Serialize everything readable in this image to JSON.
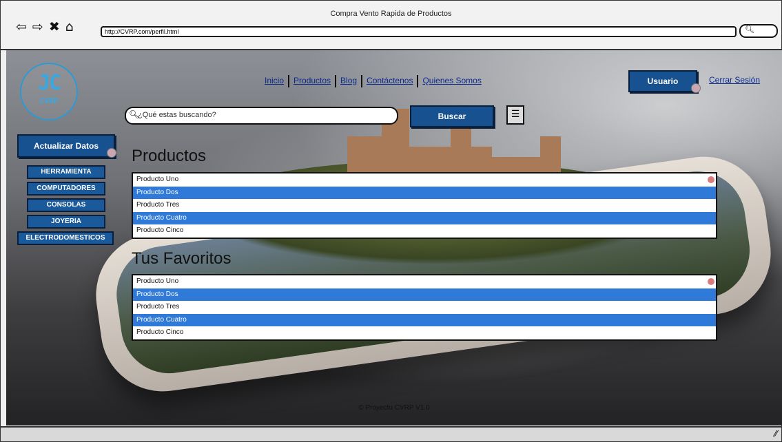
{
  "window": {
    "title": "Compra Vento Rapida de Productos",
    "url": "http://CVRP.com/perfil.html"
  },
  "logo": {
    "mark": "JC",
    "sub": "CVRP"
  },
  "nav": {
    "inicio": "Inicio",
    "productos": "Productos",
    "blog": "Blog",
    "contactenos": "Contáctenos",
    "quienes": "Quienes Somos"
  },
  "user": {
    "button": "Usuario",
    "logout": "Cerrar Sesión"
  },
  "search": {
    "placeholder": "¿Qué estas buscando?",
    "button": "Buscar"
  },
  "sidebar": {
    "update": "Actualizar Datos",
    "categories": [
      "HERRAMIENTA",
      "COMPUTADORES",
      "CONSOLAS",
      "JOYERIA",
      "ELECTRODOMESTICOS"
    ]
  },
  "productos": {
    "title": "Productos",
    "items": [
      "Producto Uno",
      "Producto Dos",
      "Producto Tres",
      "Producto Cuatro",
      "Producto Cinco"
    ]
  },
  "favoritos": {
    "title": "Tus Favoritos",
    "items": [
      "Producto Uno",
      "Producto Dos",
      "Producto Tres",
      "Producto Cuatro",
      "Producto Cinco"
    ]
  },
  "footer": "© Proyecto CVRP V1.0",
  "colors": {
    "button": "#17518f",
    "selected_row": "#2f7ad8",
    "logo": "#3aa8e0"
  }
}
